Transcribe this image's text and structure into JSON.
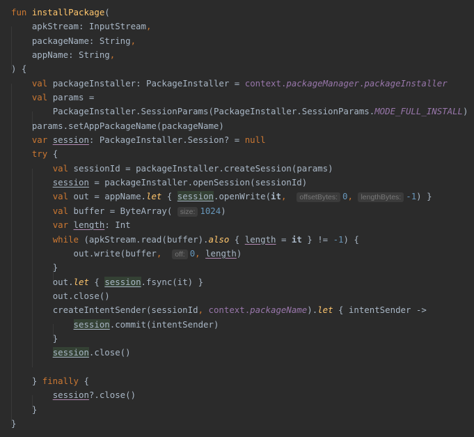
{
  "editor": {
    "language": "Kotlin",
    "function_name": "installPackage",
    "params": [
      {
        "name": "apkStream",
        "type": "InputStream"
      },
      {
        "name": "packageName",
        "type": "String"
      },
      {
        "name": "appName",
        "type": "String"
      }
    ],
    "tokens": {
      "fun": "fun",
      "val": "val",
      "var": "var",
      "try": "try",
      "while": "while",
      "finally": "finally",
      "null": "null",
      "let": "let",
      "also": "also",
      "it": "it",
      "open_paren": "(",
      "close_paren_brace": ") {",
      "comma": ",",
      "colon_sep": ": ",
      "l5_name": "packageInstaller",
      "l5_type": "PackageInstaller",
      "l5_eq": " = ",
      "l5_ctx": "context.",
      "l5_pm": "packageManager",
      "l5_dot": ".",
      "l5_pi": "packageInstaller",
      "l6_name": "params =",
      "l7_pre": "PackageInstaller.SessionParams(PackageInstaller.SessionParams.",
      "l7_const": "MODE_FULL_INSTALL",
      "l7_post": ")",
      "l8": "params.setAppPackageName(packageName)",
      "session": "session",
      "l9_type": ": PackageInstaller.Session? = ",
      "open_brace": " {",
      "l11": "sessionId = packageInstaller.createSession(params)",
      "l12_post": " = packageInstaller.openSession(sessionId)",
      "l13_pre": "out = appName.",
      "l13_mid1": " { ",
      "l13_mid2": ".openWrite(",
      "hint_offset": "offsetBytes:",
      "hint_length": "lengthBytes:",
      "zero": "0",
      "minus_one": "-1",
      "l13_end": ") }",
      "l14_pre": "buffer = ByteArray(",
      "hint_size": "size:",
      "num_1024": "1024",
      "close_paren": ")",
      "length": "length",
      "l15_type": ": Int",
      "l16_pre": " (apkStream.read(buffer).",
      "l16_mid": " { ",
      "l16_eq": " = ",
      "l16_post": " } != ",
      "l16_end": ") {",
      "l17_pre": "out.write(buffer",
      "hint_off": "off:",
      "close_brace": "}",
      "l19_pre": "out.",
      "l19_mid": " { ",
      "l19_post": ".fsync(it) }",
      "l20": "out.close()",
      "l21_pre": "createIntentSender(sessionId",
      "l21_ctx": " context.",
      "l21_pn": "packageName",
      "l21_post": ").",
      "l21_end": " { intentSender ->",
      "l22_post": ".commit(intentSender)",
      "l24_post": ".close()",
      "l26_pre": "} ",
      "l27_post": "?.close()"
    }
  }
}
